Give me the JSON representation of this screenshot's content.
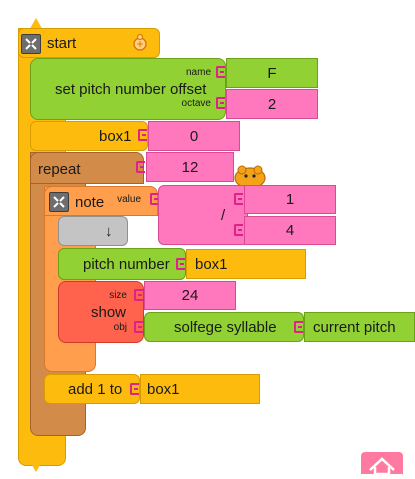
{
  "start_block": {
    "label": "start"
  },
  "set_pitch_block": {
    "label": "set pitch number offset",
    "arg1_name": "name",
    "arg2_name": "octave",
    "name_value": "F",
    "octave_value": "2"
  },
  "box1_block": {
    "label": "box1",
    "value": "0"
  },
  "repeat_block": {
    "label": "repeat",
    "count": "12"
  },
  "note_block": {
    "label": "note",
    "arg_name": "value",
    "divide_symbol": "/",
    "numerator": "1",
    "denominator": "4"
  },
  "down_block": {
    "symbol": "↓"
  },
  "pitch_number_block": {
    "label": "pitch number",
    "arg_value": "box1"
  },
  "show_block": {
    "label": "show",
    "arg1_name": "size",
    "arg2_name": "obj",
    "size_value": "24",
    "obj_label": "solfege syllable",
    "obj_value": "current pitch"
  },
  "add_block": {
    "label": "add 1 to",
    "target": "box1"
  },
  "colors": {
    "flow_orange": "#fdbb0e",
    "action_green": "#92d133",
    "number_pink": "#ff77bd",
    "repeat_brown": "#d38b4a",
    "note_orange": "#ff9e4c",
    "show_red": "#ff634d",
    "gray_block": "#c4c4c4",
    "connector": "#e0218a"
  }
}
